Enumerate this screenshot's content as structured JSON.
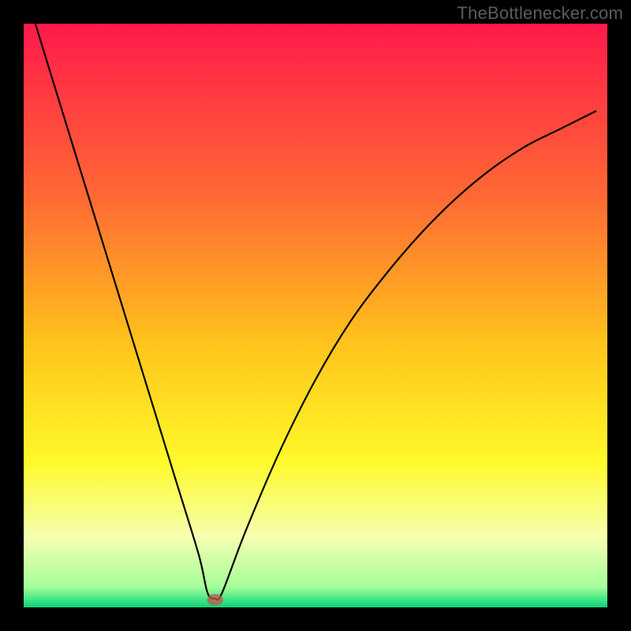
{
  "attribution": "TheBottlenecker.com",
  "chart_data": {
    "type": "line",
    "title": "",
    "xlabel": "",
    "ylabel": "",
    "xlim": [
      0,
      100
    ],
    "ylim": [
      0,
      100
    ],
    "gradient_stops": [
      {
        "offset": 0.0,
        "color": "#ff1a4b"
      },
      {
        "offset": 0.3,
        "color": "#ff6a33"
      },
      {
        "offset": 0.55,
        "color": "#ffc41b"
      },
      {
        "offset": 0.75,
        "color": "#fff92a"
      },
      {
        "offset": 0.88,
        "color": "#f5ffb0"
      },
      {
        "offset": 0.965,
        "color": "#a5ff9a"
      },
      {
        "offset": 1.0,
        "color": "#05d57a"
      }
    ],
    "series": [
      {
        "name": "curve",
        "x": [
          2,
          6,
          10,
          14,
          18,
          22,
          26,
          30,
          31.5,
          32.8,
          34,
          38,
          44,
          50,
          56,
          62,
          68,
          74,
          80,
          86,
          92,
          98
        ],
        "y": [
          100,
          87,
          74,
          61,
          48,
          35,
          22,
          9,
          2.5,
          1.5,
          2.5,
          13,
          27,
          39,
          49,
          57,
          64,
          70,
          75,
          79,
          82,
          85
        ]
      }
    ],
    "marker": {
      "x": 32.8,
      "y": 1.3,
      "rx": 1.4,
      "ry": 1.0
    }
  }
}
